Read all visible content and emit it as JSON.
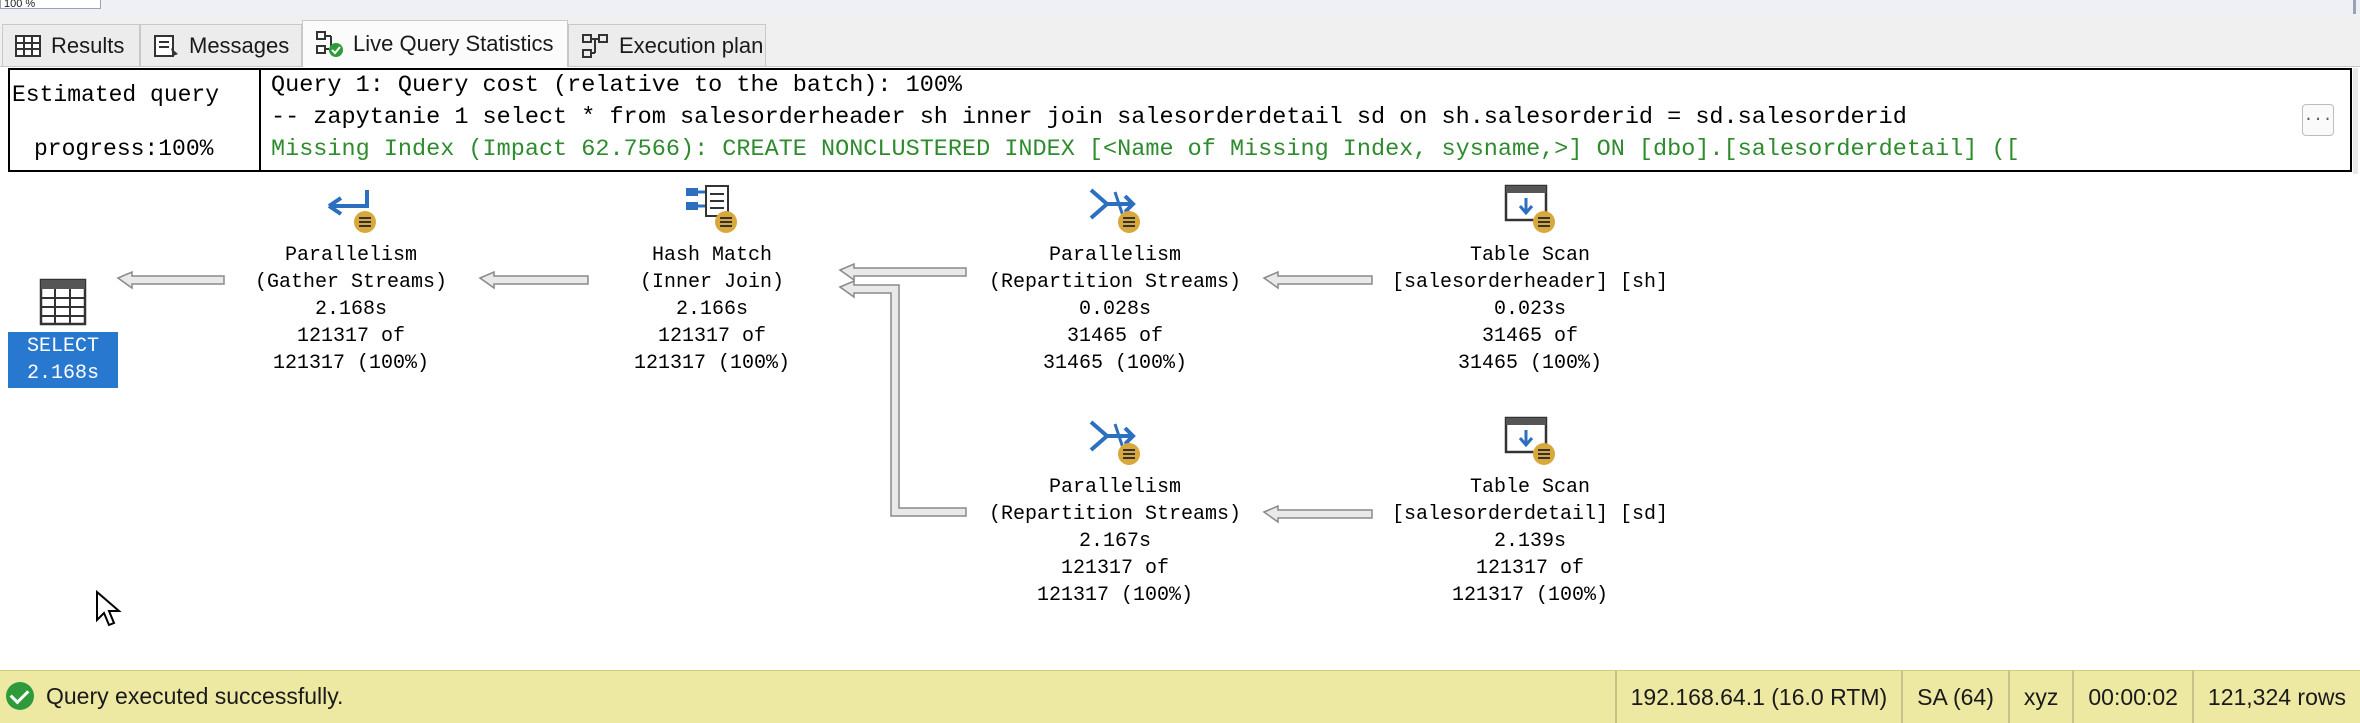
{
  "zoom": {
    "value": "100 %"
  },
  "tabs": [
    {
      "label": "Results",
      "icon": "grid-icon"
    },
    {
      "label": "Messages",
      "icon": "messages-icon"
    },
    {
      "label": "Live Query Statistics",
      "icon": "live-stats-icon"
    },
    {
      "label": "Execution plan",
      "icon": "execution-plan-icon"
    }
  ],
  "progress": {
    "line1": "Estimated query",
    "line2": "progress:100%"
  },
  "query": {
    "cost_line": "Query 1: Query cost (relative to the batch): 100%",
    "sql_line": "-- zapytanie 1 select * from salesorderheader sh inner join salesorderdetail sd on sh.salesorderid = sd.salesorderid",
    "missing_index_line": "Missing Index (Impact 62.7566): CREATE NONCLUSTERED INDEX [<Name of Missing Index, sysname,>] ON [dbo].[salesorderdetail] ([",
    "more_button": "..."
  },
  "plan": {
    "select": {
      "label": "SELECT",
      "time": "2.168s",
      "icon": "select-icon"
    },
    "gather": {
      "name": "Parallelism",
      "sub": "(Gather Streams)",
      "time": "2.168s",
      "rows": "121317 of",
      "est": "121317 (100%)",
      "icon": "parallelism-gather-icon"
    },
    "hash": {
      "name": "Hash Match",
      "sub": "(Inner Join)",
      "time": "2.166s",
      "rows": "121317 of",
      "est": "121317 (100%)",
      "icon": "hash-match-icon"
    },
    "repart1": {
      "name": "Parallelism",
      "sub": "(Repartition Streams)",
      "time": "0.028s",
      "rows": "31465 of",
      "est": "31465 (100%)",
      "icon": "parallelism-repartition-icon"
    },
    "scan1": {
      "name": "Table Scan",
      "sub": "[salesorderheader] [sh]",
      "time": "0.023s",
      "rows": "31465 of",
      "est": "31465 (100%)",
      "icon": "table-scan-icon"
    },
    "repart2": {
      "name": "Parallelism",
      "sub": "(Repartition Streams)",
      "time": "2.167s",
      "rows": "121317 of",
      "est": "121317 (100%)",
      "icon": "parallelism-repartition-icon"
    },
    "scan2": {
      "name": "Table Scan",
      "sub": "[salesorderdetail] [sd]",
      "time": "2.139s",
      "rows": "121317 of",
      "est": "121317 (100%)",
      "icon": "table-scan-icon"
    }
  },
  "status": {
    "message": "Query executed successfully.",
    "server": "192.168.64.1 (16.0 RTM)",
    "user": "SA (64)",
    "database": "xyz",
    "elapsed": "00:00:02",
    "rows": "121,324 rows"
  },
  "colors": {
    "selected": "#2878d0",
    "status_bg": "#ede8a2",
    "missing_index": "#2e8b2e",
    "icon_blue": "#2c6fbf",
    "icon_gold": "#d8a83a"
  }
}
